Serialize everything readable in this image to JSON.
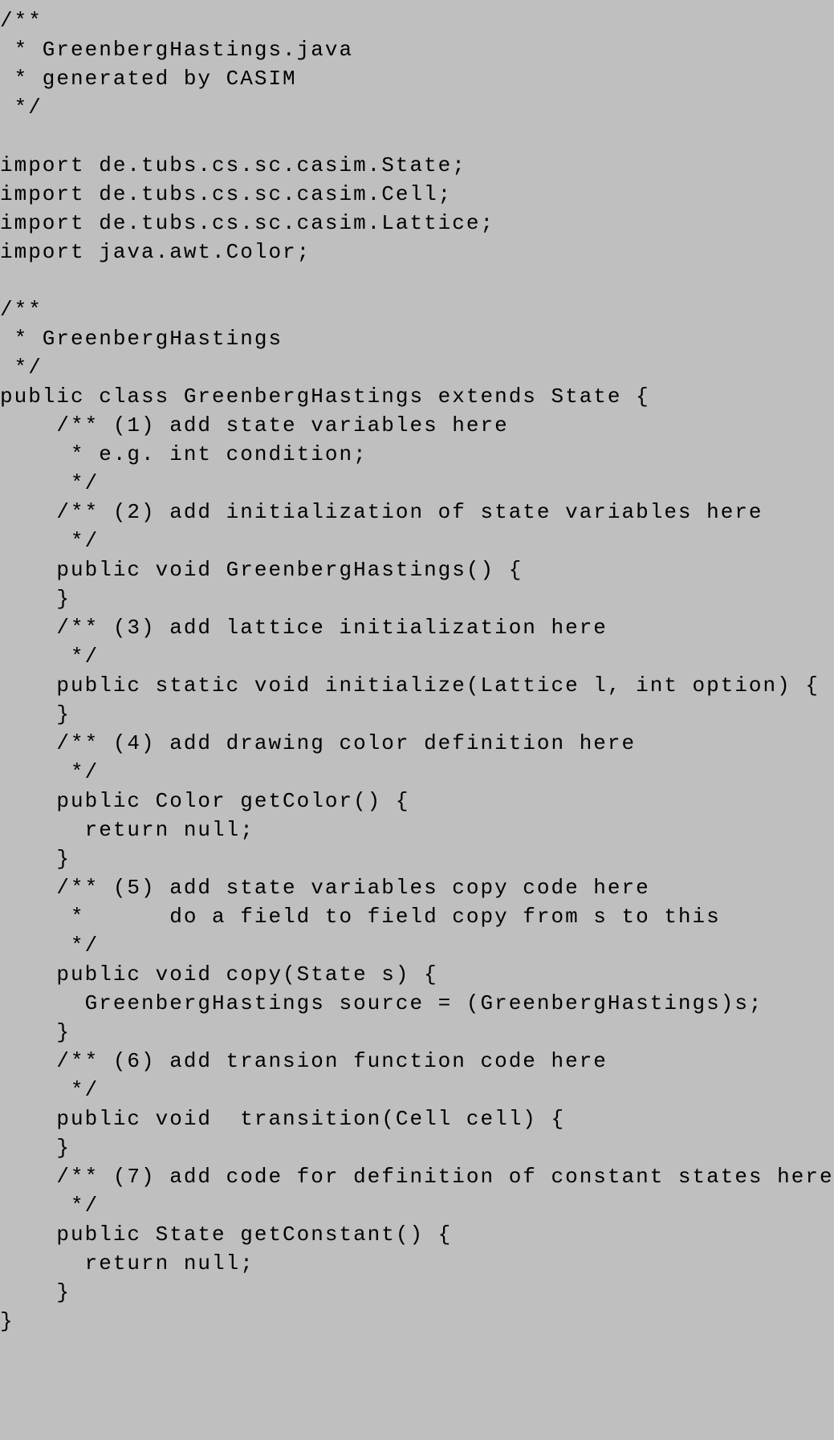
{
  "code": {
    "lines": [
      "/**",
      " * GreenbergHastings.java",
      " * generated by CASIM",
      " */",
      "",
      "import de.tubs.cs.sc.casim.State;",
      "import de.tubs.cs.sc.casim.Cell;",
      "import de.tubs.cs.sc.casim.Lattice;",
      "import java.awt.Color;",
      "",
      "/**",
      " * GreenbergHastings",
      " */",
      "public class GreenbergHastings extends State {",
      "    /** (1) add state variables here",
      "     * e.g. int condition;",
      "     */",
      "    /** (2) add initialization of state variables here",
      "     */",
      "    public void GreenbergHastings() {",
      "    }",
      "    /** (3) add lattice initialization here",
      "     */",
      "    public static void initialize(Lattice l, int option) {",
      "    }",
      "    /** (4) add drawing color definition here",
      "     */",
      "    public Color getColor() {",
      "      return null;",
      "    }",
      "    /** (5) add state variables copy code here",
      "     *      do a field to field copy from s to this",
      "     */",
      "    public void copy(State s) {",
      "      GreenbergHastings source = (GreenbergHastings)s;",
      "    }",
      "    /** (6) add transion function code here",
      "     */",
      "    public void  transition(Cell cell) {",
      "    }",
      "    /** (7) add code for definition of constant states here",
      "     */",
      "    public State getConstant() {",
      "      return null;",
      "    }",
      "}"
    ]
  }
}
